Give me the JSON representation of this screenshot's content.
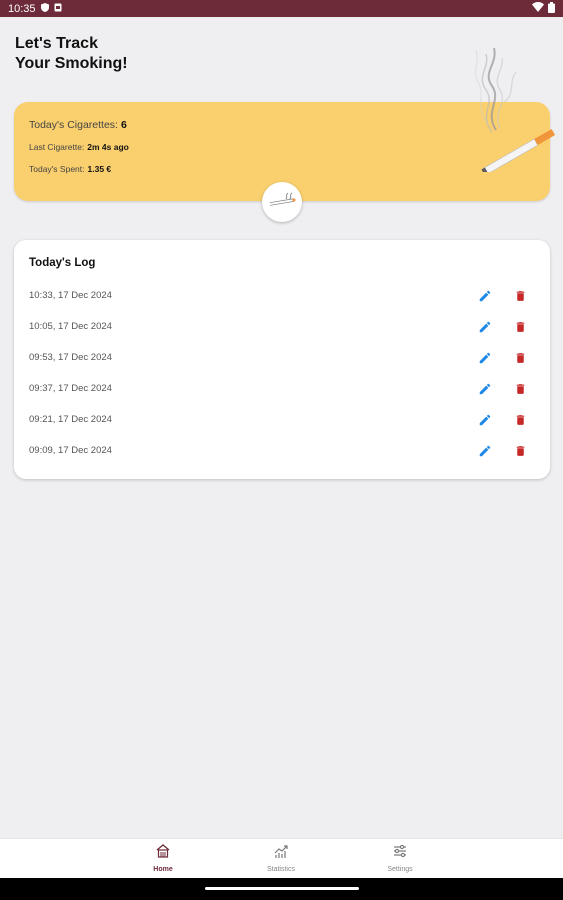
{
  "status_bar": {
    "time": "10:35",
    "icons": [
      "shield-icon",
      "sim-card-icon",
      "wifi-icon",
      "battery-icon"
    ]
  },
  "header": {
    "title_line1": "Let's Track",
    "title_line2": "Your Smoking!"
  },
  "summary": {
    "count_label": "Today's Cigarettes:",
    "count_value": "6",
    "last_label": "Last Cigarette:",
    "last_value": "2m 4s ago",
    "spent_label": "Today's Spent:",
    "spent_value": "1.35 €",
    "background_color": "#fad06e"
  },
  "log": {
    "title": "Today's Log",
    "entries": [
      {
        "time": "10:33, 17 Dec 2024"
      },
      {
        "time": "10:05, 17 Dec 2024"
      },
      {
        "time": "09:53, 17 Dec 2024"
      },
      {
        "time": "09:37, 17 Dec 2024"
      },
      {
        "time": "09:21, 17 Dec 2024"
      },
      {
        "time": "09:09, 17 Dec 2024"
      }
    ],
    "edit_icon": "pencil-icon",
    "delete_icon": "trash-icon",
    "edit_color": "#1e88e5",
    "delete_color": "#c62828"
  },
  "bottom_nav": {
    "items": [
      {
        "label": "Home",
        "icon": "home-icon",
        "active": true
      },
      {
        "label": "Statistics",
        "icon": "chart-icon",
        "active": false
      },
      {
        "label": "Settings",
        "icon": "sliders-icon",
        "active": false
      }
    ],
    "accent_color": "#6d2a39"
  }
}
